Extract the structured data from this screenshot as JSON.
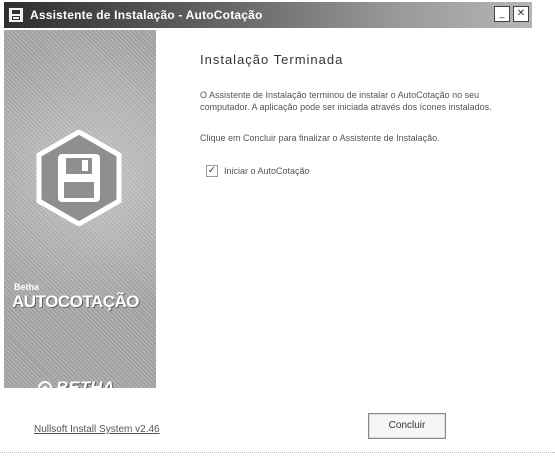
{
  "window": {
    "title": "Assistente de Instalação - AutoCotação",
    "minimize_glyph": "_",
    "close_glyph": "✕"
  },
  "banner": {
    "product_prefix": "Betha",
    "product_name": "AUTOCOTAÇÃO",
    "brand_name": "BETHA"
  },
  "content": {
    "heading": "Instalação Terminada",
    "paragraph": "O Assistente de Instalação terminou de instalar o AutoCotação no seu computador. A aplicação pode ser iniciada através dos ícones instalados.",
    "instruction": "Clique em Concluir para finalizar o Assistente de Instalação.",
    "launch_checkbox": {
      "label": "Iniciar o AutoCotação",
      "checked": true,
      "check_glyph": "✓"
    }
  },
  "footer": {
    "link_label": "Nullsoft Install System v2.46",
    "finish_button": "Concluir"
  },
  "colors": {
    "titlebar_dark": "#2e2e2e",
    "titlebar_light": "#b5b5b5",
    "banner_gray": "#a8a8a8"
  }
}
